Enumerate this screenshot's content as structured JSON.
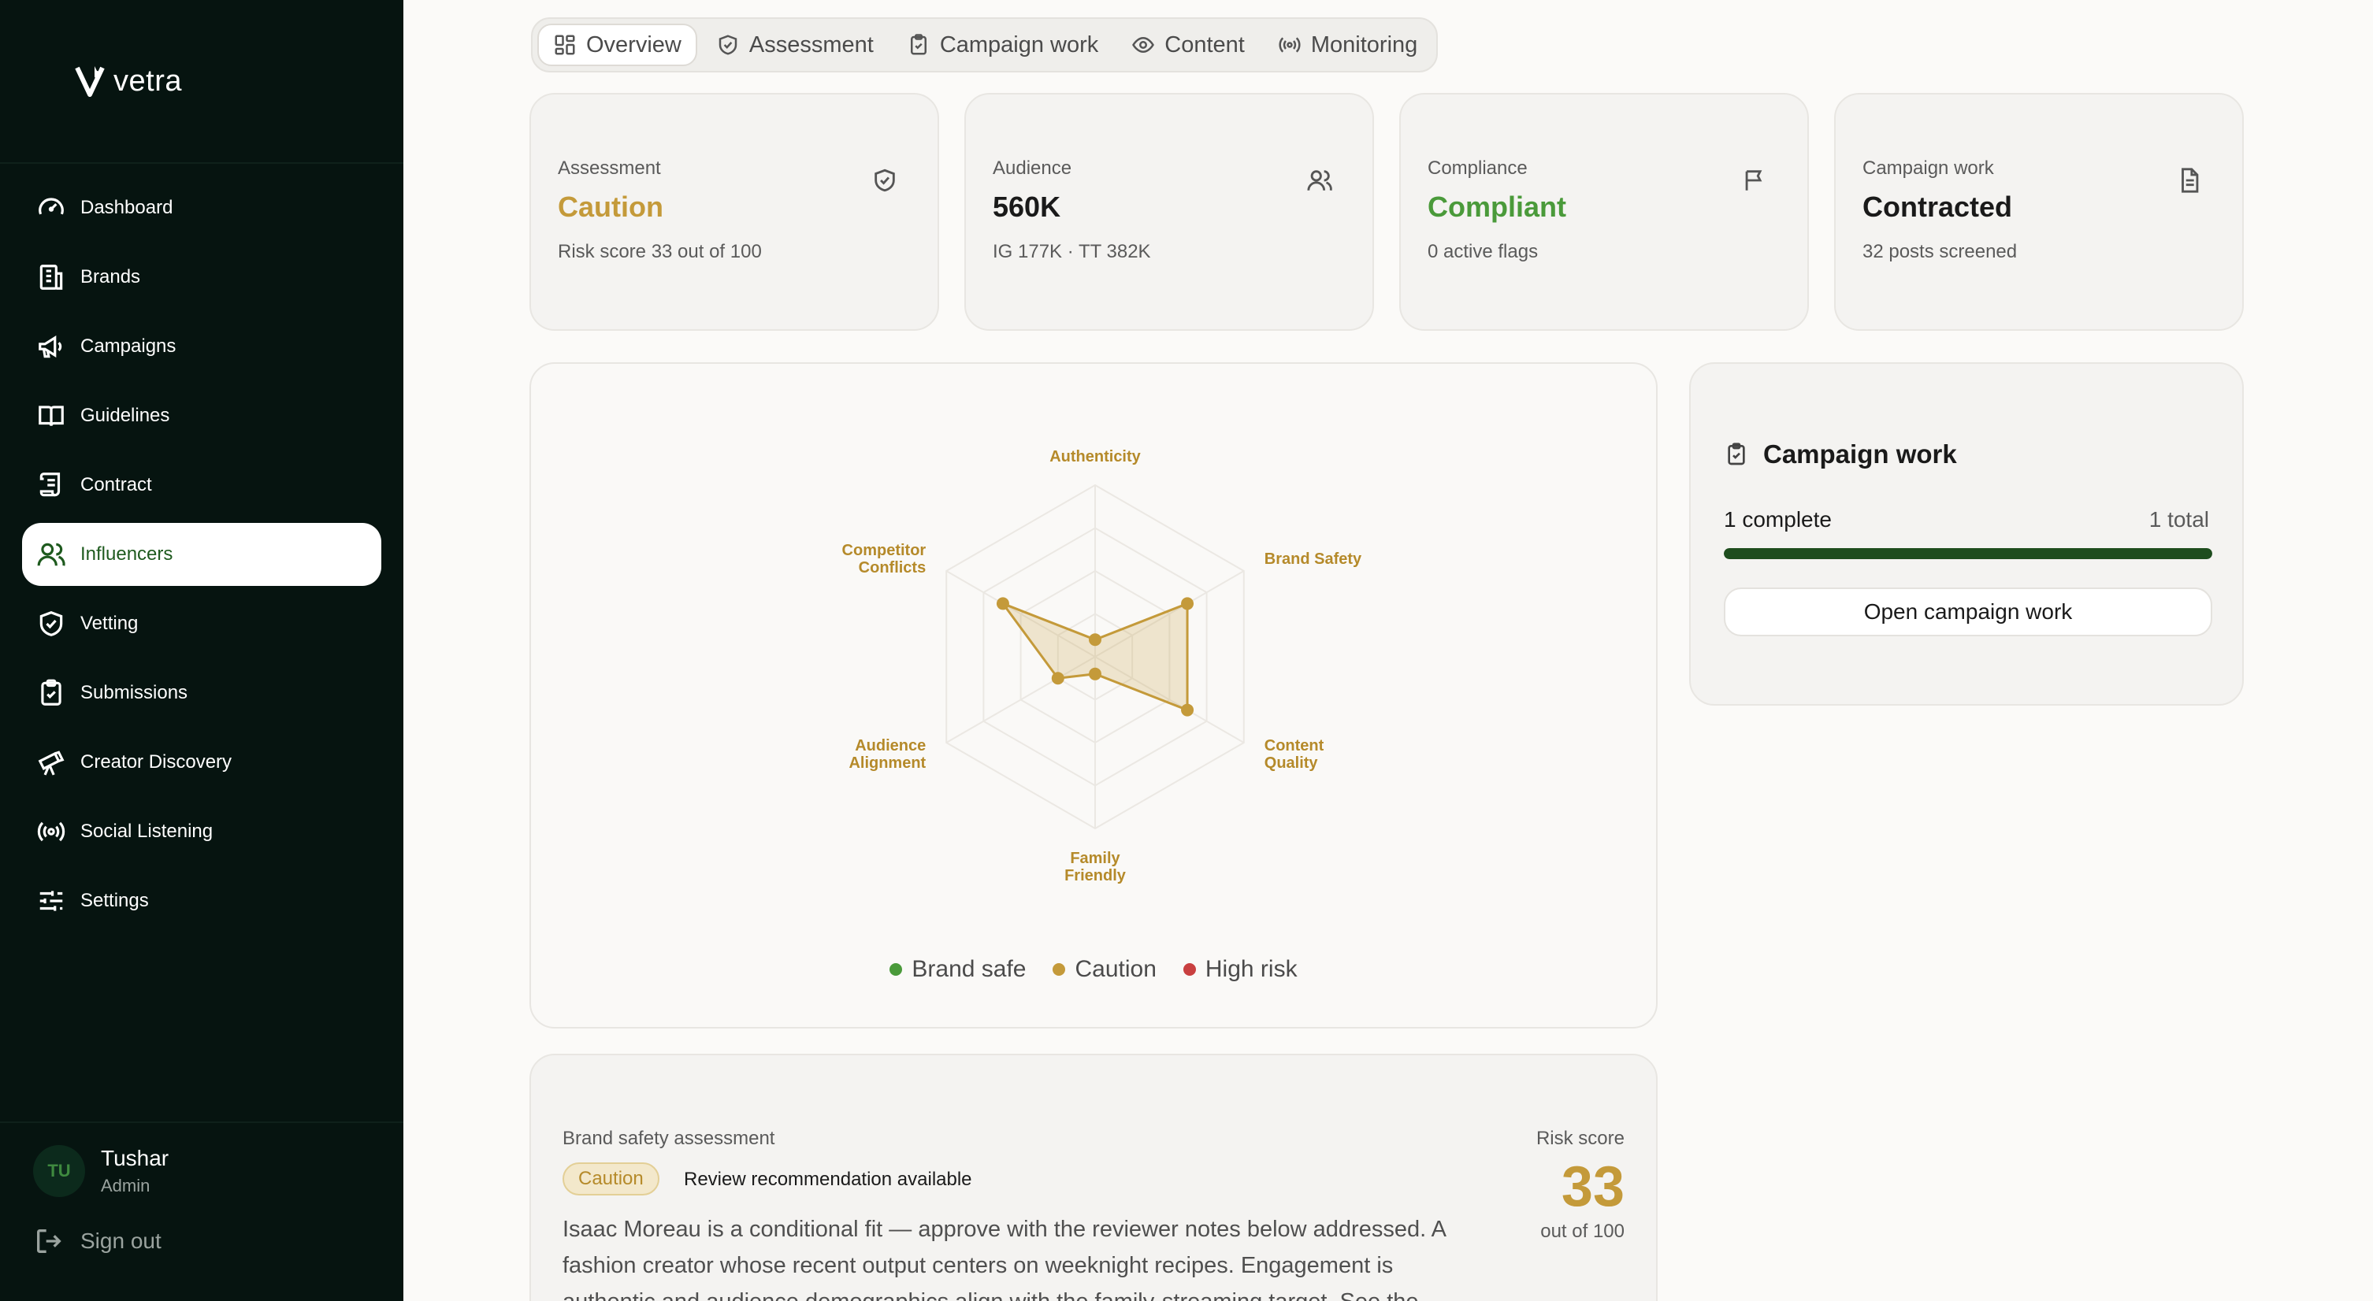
{
  "app": {
    "name": "vetra"
  },
  "sidebar": {
    "items": [
      {
        "label": "Dashboard",
        "icon": "gauge-icon"
      },
      {
        "label": "Brands",
        "icon": "building-icon"
      },
      {
        "label": "Campaigns",
        "icon": "megaphone-icon"
      },
      {
        "label": "Guidelines",
        "icon": "book-icon"
      },
      {
        "label": "Contract",
        "icon": "scroll-icon"
      },
      {
        "label": "Influencers",
        "icon": "users-icon",
        "active": true
      },
      {
        "label": "Vetting",
        "icon": "shield-check-icon"
      },
      {
        "label": "Submissions",
        "icon": "clipboard-check-icon"
      },
      {
        "label": "Creator Discovery",
        "icon": "telescope-icon"
      },
      {
        "label": "Social Listening",
        "icon": "broadcast-icon"
      },
      {
        "label": "Settings",
        "icon": "sliders-icon"
      }
    ],
    "user": {
      "initials": "TU",
      "name": "Tushar",
      "role": "Admin"
    },
    "signout_label": "Sign out"
  },
  "tabs": [
    {
      "label": "Overview",
      "icon": "grid-icon",
      "active": true
    },
    {
      "label": "Assessment",
      "icon": "shield-check-icon"
    },
    {
      "label": "Campaign work",
      "icon": "clipboard-check-icon"
    },
    {
      "label": "Content",
      "icon": "eye-icon"
    },
    {
      "label": "Monitoring",
      "icon": "broadcast-icon"
    }
  ],
  "stats": [
    {
      "label": "Assessment",
      "value": "Caution",
      "sub": "Risk score 33 out of 100",
      "icon": "shield-check-icon",
      "color": "#c49a3a"
    },
    {
      "label": "Audience",
      "value": "560K",
      "sub": "IG 177K · TT 382K",
      "icon": "users-icon",
      "color": "#111111"
    },
    {
      "label": "Compliance",
      "value": "Compliant",
      "sub": "0 active flags",
      "icon": "flag-icon",
      "color": "#4a9a3a"
    },
    {
      "label": "Campaign work",
      "value": "Contracted",
      "sub": "32 posts screened",
      "icon": "document-icon",
      "color": "#111111"
    }
  ],
  "chart_data": {
    "type": "radar",
    "axes": [
      "Authenticity",
      "Brand Safety",
      "Content Quality",
      "Family Friendly",
      "Audience Alignment",
      "Competitor Conflicts"
    ],
    "axis_lines": [
      [
        "Authenticity"
      ],
      [
        "Brand Safety"
      ],
      [
        "Content",
        "Quality"
      ],
      [
        "Family",
        "Friendly"
      ],
      [
        "Audience",
        "Alignment"
      ],
      [
        "Competitor",
        "Conflicts"
      ]
    ],
    "max": 100,
    "rings": 4,
    "series": [
      {
        "values": [
          10,
          62,
          62,
          10,
          25,
          62
        ]
      }
    ],
    "legend": [
      {
        "label": "Brand safe",
        "color": "#4a9a3a"
      },
      {
        "label": "Caution",
        "color": "#c49a3a"
      },
      {
        "label": "High risk",
        "color": "#c94040"
      }
    ],
    "colors": {
      "stroke": "#c49a3a",
      "fill": "#c49a3a",
      "label": "#b58a2a",
      "grid": "#ebe8e3"
    }
  },
  "campaign_work": {
    "title": "Campaign work",
    "complete_label": "1 complete",
    "total_label": "1 total",
    "progress": 1.0,
    "button_label": "Open campaign work"
  },
  "assessment": {
    "label": "Brand safety assessment",
    "badge": "Caution",
    "recommendation": "Review recommendation available",
    "body": "Isaac Moreau is a conditional fit — approve with the reviewer notes below addressed. A fashion creator whose recent output centers on weeknight recipes. Engagement is authentic and audience demographics align with the family-streaming target. See the dimension",
    "risk_label": "Risk score",
    "risk_value": "33",
    "risk_sub": "out of 100"
  }
}
